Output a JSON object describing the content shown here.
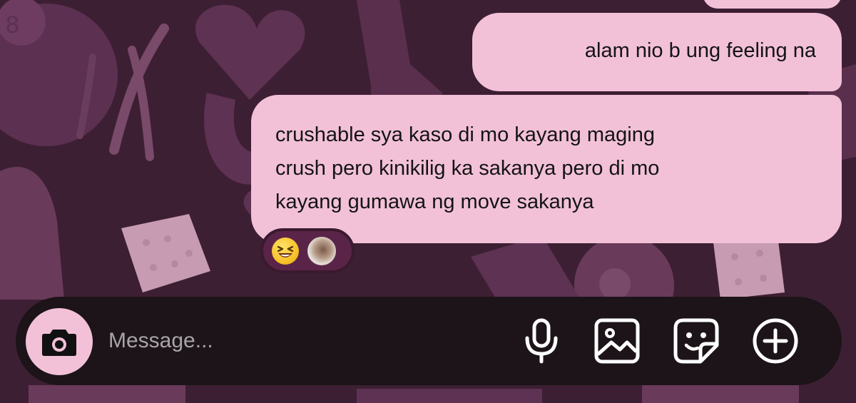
{
  "messages": [
    {
      "id": "msg-1",
      "text": "alam nio b ung feeling na"
    },
    {
      "id": "msg-2",
      "lines": [
        "crushable sya kaso di mo kayang maging",
        "crush pero kinikilig ka sakanya pero di mo",
        "kayang gumawa ng move sakanya"
      ]
    }
  ],
  "reaction": {
    "emoji": "laughing-face",
    "reactor": "user-avatar"
  },
  "composer": {
    "placeholder": "Message...",
    "icons": [
      "camera-icon",
      "microphone-icon",
      "gallery-icon",
      "sticker-icon",
      "plus-icon"
    ]
  },
  "colors": {
    "bubble": "#f2c1d8",
    "background": "#3d1f33",
    "composer": "#1c1418",
    "camera_button": "#f2c1d8",
    "reaction_pill": "#5a2448"
  }
}
